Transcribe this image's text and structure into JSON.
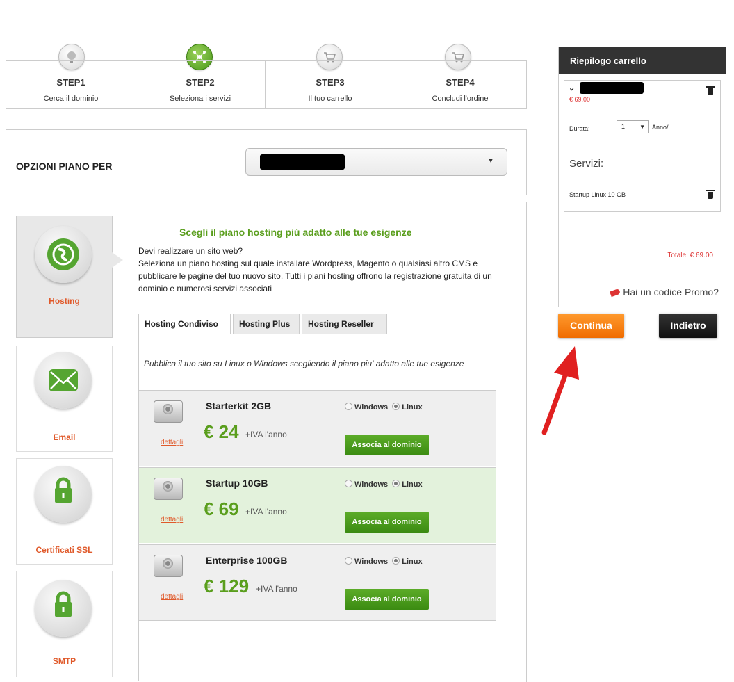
{
  "steps": [
    {
      "num": "STEP1",
      "label": "Cerca il dominio",
      "icon": "globe-icon"
    },
    {
      "num": "STEP2",
      "label": "Seleziona i servizi",
      "icon": "network-icon"
    },
    {
      "num": "STEP3",
      "label": "Il tuo carrello",
      "icon": "cart-icon"
    },
    {
      "num": "STEP4",
      "label": "Concludi l'ordine",
      "icon": "cart-icon"
    }
  ],
  "options": {
    "title": "OPZIONI PIANO PER",
    "selected_value_redacted": true
  },
  "categories": [
    {
      "label": "Hosting",
      "icon": "globe-icon"
    },
    {
      "label": "Email",
      "icon": "envelope-icon"
    },
    {
      "label": "Certificati SSL",
      "icon": "lock-icon"
    },
    {
      "label": "SMTP",
      "icon": "lock-icon"
    }
  ],
  "plan_section": {
    "heading": "Scegli il piano hosting piú adatto alle tue esigenze",
    "line1": "Devi realizzare un sito web?",
    "line2": "Seleziona un piano hosting sul quale installare Wordpress, Magento o qualsiasi altro CMS e pubblicare le pagine del tuo nuovo sito. Tutti i piani hosting offrono la registrazione gratuita di un dominio e numerosi servizi associati"
  },
  "tabs": [
    "Hosting Condiviso",
    "Hosting Plus",
    "Hosting Reseller"
  ],
  "tab_note": "Pubblica il tuo sito su Linux o Windows scegliendo il piano piu' adatto alle tue esigenze",
  "plans": [
    {
      "name": "Starterkit 2GB",
      "price": "€ 24",
      "iva": "+IVA l'anno",
      "details": "dettagli",
      "os_windows": "Windows",
      "os_linux": "Linux",
      "button": "Associa al dominio"
    },
    {
      "name": "Startup 10GB",
      "price": "€ 69",
      "iva": "+IVA l'anno",
      "details": "dettagli",
      "os_windows": "Windows",
      "os_linux": "Linux",
      "button": "Associa al dominio"
    },
    {
      "name": "Enterprise 100GB",
      "price": "€ 129",
      "iva": "+IVA l'anno",
      "details": "dettagli",
      "os_windows": "Windows",
      "os_linux": "Linux",
      "button": "Associa al dominio"
    }
  ],
  "cart": {
    "title": "Riepilogo carrello",
    "item_price": "€ 69.00",
    "duration_label": "Durata:",
    "duration_value": "1",
    "duration_unit": "Anno/i",
    "services_label": "Servizi:",
    "service_item": "Startup Linux 10 GB",
    "total": "Totale: € 69.00",
    "promo": "Hai un codice Promo?"
  },
  "buttons": {
    "continua": "Continua",
    "indietro": "Indietro"
  },
  "colors": {
    "accent_green": "#5a9e1d",
    "accent_orange": "#f06c00",
    "label_red": "#e05a2b"
  }
}
